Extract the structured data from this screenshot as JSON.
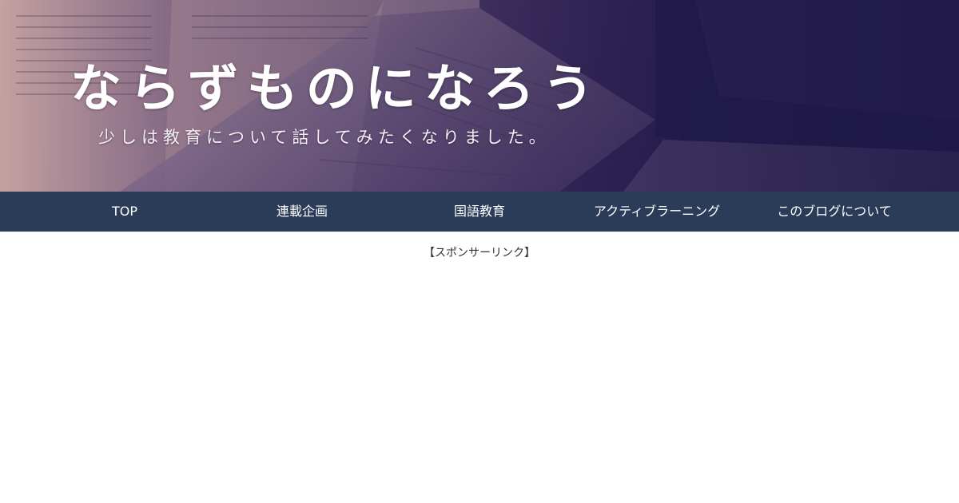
{
  "header": {
    "title": "ならずものになろう",
    "tagline": "少しは教育について話してみたくなりました。"
  },
  "nav": {
    "items": [
      {
        "label": "TOP"
      },
      {
        "label": "連載企画"
      },
      {
        "label": "国語教育"
      },
      {
        "label": "アクティブラーニング"
      },
      {
        "label": "このブログについて"
      }
    ]
  },
  "main": {
    "sponsor_label": "【スポンサーリンク】"
  },
  "colors": {
    "nav_background": "#2a3c58",
    "nav_text": "#ffffff",
    "banner_tint": "#2e2248"
  },
  "icons": {
    "banner_image": "open-books-photo"
  }
}
